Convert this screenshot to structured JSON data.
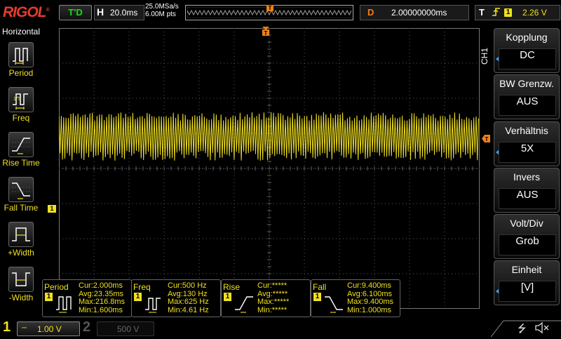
{
  "brand": "RIGOL",
  "brand_mark": "®",
  "top": {
    "run_status": "T'D",
    "timebase_label": "H",
    "timebase_value": "20.0ms",
    "sample_rate": "25.0MSa/s",
    "memory_depth": "6.00M pts",
    "trigger_marker": "T",
    "delay_label": "D",
    "delay_value": "2.00000000ms",
    "trigger_label": "T",
    "trigger_edge": "rising-edge",
    "trigger_source": "1",
    "trigger_level": "2.26 V"
  },
  "left_menu": {
    "title": "Horizontal",
    "items": [
      {
        "label": "Period",
        "icon": "period-icon"
      },
      {
        "label": "Freq",
        "icon": "frequency-icon"
      },
      {
        "label": "Rise Time",
        "icon": "rise-time-icon"
      },
      {
        "label": "Fall Time",
        "icon": "fall-time-icon"
      },
      {
        "label": "+Width",
        "icon": "positive-width-icon"
      },
      {
        "label": "-Width",
        "icon": "negative-width-icon"
      }
    ]
  },
  "channel1_marker": "1",
  "right_menu": {
    "channel_tag": "CH1",
    "items": [
      {
        "label": "Kopplung",
        "value": "DC"
      },
      {
        "label": "BW Grenzw.",
        "value": "AUS"
      },
      {
        "label": "Verhältnis",
        "value": "5X"
      },
      {
        "label": "Invers",
        "value": "AUS"
      },
      {
        "label": "Volt/Div",
        "value": "Grob"
      },
      {
        "label": "Einheit",
        "value": "[V]"
      }
    ]
  },
  "measurements": [
    {
      "name": "Period",
      "source": "1",
      "cur": "Cur:2.000ms",
      "avg": "Avg:23.35ms",
      "max": "Max:216.8ms",
      "min": "Min:1.600ms"
    },
    {
      "name": "Freq",
      "source": "1",
      "cur": "Cur:500 Hz",
      "avg": "Avg:130 Hz",
      "max": "Max:625 Hz",
      "min": "Min:4.61 Hz"
    },
    {
      "name": "Rise",
      "source": "1",
      "cur": "Cur:*****",
      "avg": "Avg:*****",
      "max": "Max:*****",
      "min": "Min:*****"
    },
    {
      "name": "Fall",
      "source": "1",
      "cur": "Cur:9.400ms",
      "avg": "Avg:6.100ms",
      "max": "Max:9.400ms",
      "min": "Min:1.000ms"
    }
  ],
  "bottom": {
    "ch1_number": "1",
    "ch1_scale": "1.00 V",
    "ch2_number": "2",
    "ch2_scale": "500 V",
    "usb_icon": "usb-icon",
    "mute_icon": "speaker-mute-icon"
  },
  "colors": {
    "channel1": "#f0e020",
    "trigger_marker": "#f08018",
    "status_green": "#1cdc1c",
    "menu_arrow": "#38a0ff",
    "grid": "#5a5a5a",
    "brand": "#e63b2e"
  }
}
